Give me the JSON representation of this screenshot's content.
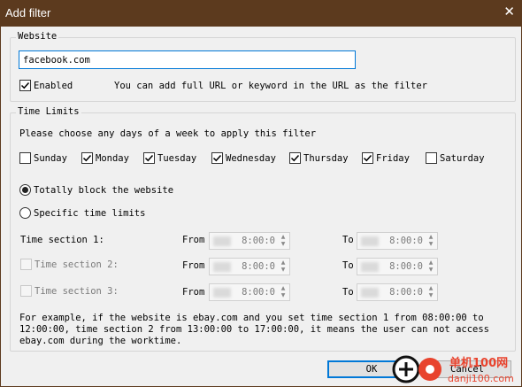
{
  "window": {
    "title": "Add filter",
    "close_glyph": "✕"
  },
  "website": {
    "legend": "Website",
    "url_value": "facebook.com",
    "enabled_label": "Enabled",
    "enabled_checked": true,
    "hint": "You can add full URL or keyword in the URL as the filter"
  },
  "time_limits": {
    "legend": "Time Limits",
    "days_prompt": "Please choose any days of a week to apply this filter",
    "days": [
      {
        "label": "Sunday",
        "checked": false
      },
      {
        "label": "Monday",
        "checked": true
      },
      {
        "label": "Tuesday",
        "checked": true
      },
      {
        "label": "Wednesday",
        "checked": true
      },
      {
        "label": "Thursday",
        "checked": true
      },
      {
        "label": "Friday",
        "checked": true
      },
      {
        "label": "Saturday",
        "checked": false
      }
    ],
    "mode_block_label": "Totally block the website",
    "mode_specific_label": "Specific time limits",
    "selected_mode": "block",
    "sections": [
      {
        "label": "Time section 1:",
        "has_checkbox": false,
        "from_label": "From",
        "from_value": "8:00:0",
        "to_label": "To",
        "to_value": "8:00:0"
      },
      {
        "label": "Time section 2:",
        "has_checkbox": true,
        "from_label": "From",
        "from_value": "8:00:0",
        "to_label": "To",
        "to_value": "8:00:0"
      },
      {
        "label": "Time section 3:",
        "has_checkbox": true,
        "from_label": "From",
        "from_value": "8:00:0",
        "to_label": "To",
        "to_value": "8:00:0"
      }
    ],
    "example_lines": [
      "For example, if the website is ebay.com and you set  time section 1 from 08:00:00 to",
      "12:00:00, time section 2 from 13:00:00 to 17:00:00, it means the user can not access",
      "ebay.com during the worktime."
    ]
  },
  "buttons": {
    "ok": "OK",
    "cancel": "Cancel"
  },
  "watermark": {
    "line1": "单机100网",
    "line2": "danji100.com",
    "accent": "#e8432d"
  },
  "colors": {
    "titlebar": "#5c3a1e",
    "focus": "#0078d7"
  }
}
